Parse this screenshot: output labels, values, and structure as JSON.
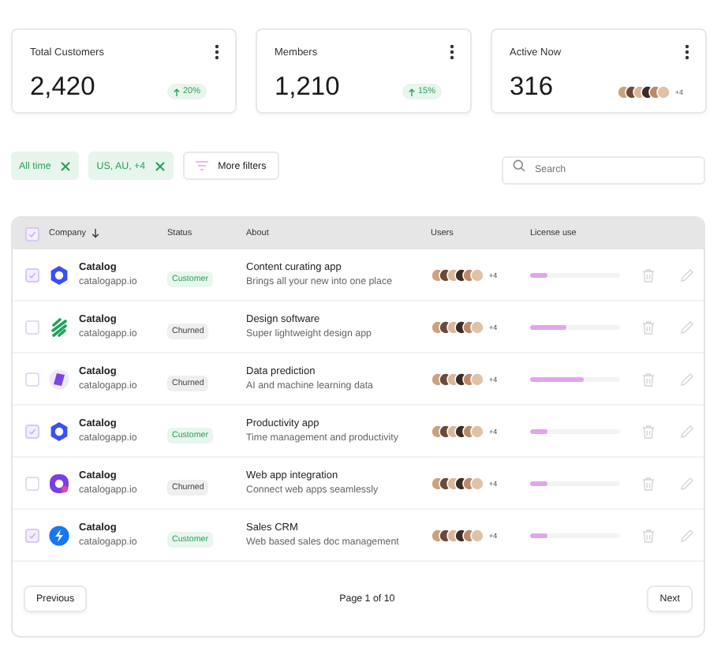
{
  "stats": [
    {
      "kind": "trend",
      "label": "Total Customers",
      "value": "2,420",
      "change": "20%"
    },
    {
      "kind": "trend",
      "label": "Members",
      "value": "1,210",
      "change": "15%"
    },
    {
      "kind": "avatars",
      "label": "Active Now",
      "value": "316",
      "more": "+4"
    }
  ],
  "filters": [
    {
      "label": "All time"
    },
    {
      "label": "US, AU, +4"
    }
  ],
  "more_filters": "More filters",
  "search": {
    "placeholder": "Search"
  },
  "table": {
    "all_checked": true,
    "columns": [
      "Company",
      "Status",
      "About",
      "Users",
      "License use"
    ],
    "rows": [
      {
        "checked": true,
        "logo": {
          "kind": "ring"
        },
        "company": "Catalog",
        "domain": "catalogapp.io",
        "status": {
          "kind": "customer",
          "label": "Customer"
        },
        "title": "Content curating app",
        "desc": "Brings all your new into one place",
        "more": "+4",
        "level": 0.2
      },
      {
        "checked": false,
        "logo": {
          "kind": "stripes"
        },
        "company": "Catalog",
        "domain": "catalogapp.io",
        "status": {
          "kind": "churned",
          "label": "Churned"
        },
        "title": "Design software",
        "desc": "Super lightweight design app",
        "more": "+4",
        "level": 0.4
      },
      {
        "checked": false,
        "logo": {
          "kind": "gem"
        },
        "company": "Catalog",
        "domain": "catalogapp.io",
        "status": {
          "kind": "churned",
          "label": "Churned"
        },
        "title": "Data prediction",
        "desc": "AI and machine learning data",
        "more": "+4",
        "level": 0.6
      },
      {
        "checked": true,
        "logo": {
          "kind": "ring"
        },
        "company": "Catalog",
        "domain": "catalogapp.io",
        "status": {
          "kind": "customer",
          "label": "Customer"
        },
        "title": "Productivity app",
        "desc": "Time management and productivity",
        "more": "+4",
        "level": 0.2
      },
      {
        "checked": false,
        "logo": {
          "kind": "q"
        },
        "company": "Catalog",
        "domain": "catalogapp.io",
        "status": {
          "kind": "churned",
          "label": "Churned"
        },
        "title": "Web app integration",
        "desc": "Connect web apps seamlessly",
        "more": "+4",
        "level": 0.2
      },
      {
        "checked": true,
        "logo": {
          "kind": "bolt"
        },
        "company": "Catalog",
        "domain": "catalogapp.io",
        "status": {
          "kind": "customer",
          "label": "Customer"
        },
        "title": "Sales CRM",
        "desc": "Web based sales doc management",
        "more": "+4",
        "level": 0.2
      }
    ]
  },
  "pagination": {
    "previous": "Previous",
    "page": "Page 1 of 10",
    "next": "Next"
  }
}
